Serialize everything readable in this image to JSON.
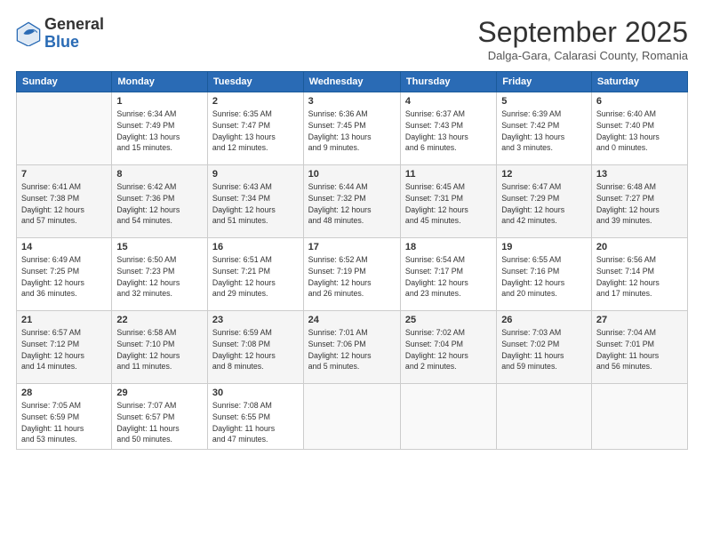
{
  "header": {
    "logo_general": "General",
    "logo_blue": "Blue",
    "month_title": "September 2025",
    "location": "Dalga-Gara, Calarasi County, Romania"
  },
  "columns": [
    "Sunday",
    "Monday",
    "Tuesday",
    "Wednesday",
    "Thursday",
    "Friday",
    "Saturday"
  ],
  "weeks": [
    [
      {
        "day": "",
        "info": ""
      },
      {
        "day": "1",
        "info": "Sunrise: 6:34 AM\nSunset: 7:49 PM\nDaylight: 13 hours\nand 15 minutes."
      },
      {
        "day": "2",
        "info": "Sunrise: 6:35 AM\nSunset: 7:47 PM\nDaylight: 13 hours\nand 12 minutes."
      },
      {
        "day": "3",
        "info": "Sunrise: 6:36 AM\nSunset: 7:45 PM\nDaylight: 13 hours\nand 9 minutes."
      },
      {
        "day": "4",
        "info": "Sunrise: 6:37 AM\nSunset: 7:43 PM\nDaylight: 13 hours\nand 6 minutes."
      },
      {
        "day": "5",
        "info": "Sunrise: 6:39 AM\nSunset: 7:42 PM\nDaylight: 13 hours\nand 3 minutes."
      },
      {
        "day": "6",
        "info": "Sunrise: 6:40 AM\nSunset: 7:40 PM\nDaylight: 13 hours\nand 0 minutes."
      }
    ],
    [
      {
        "day": "7",
        "info": "Sunrise: 6:41 AM\nSunset: 7:38 PM\nDaylight: 12 hours\nand 57 minutes."
      },
      {
        "day": "8",
        "info": "Sunrise: 6:42 AM\nSunset: 7:36 PM\nDaylight: 12 hours\nand 54 minutes."
      },
      {
        "day": "9",
        "info": "Sunrise: 6:43 AM\nSunset: 7:34 PM\nDaylight: 12 hours\nand 51 minutes."
      },
      {
        "day": "10",
        "info": "Sunrise: 6:44 AM\nSunset: 7:32 PM\nDaylight: 12 hours\nand 48 minutes."
      },
      {
        "day": "11",
        "info": "Sunrise: 6:45 AM\nSunset: 7:31 PM\nDaylight: 12 hours\nand 45 minutes."
      },
      {
        "day": "12",
        "info": "Sunrise: 6:47 AM\nSunset: 7:29 PM\nDaylight: 12 hours\nand 42 minutes."
      },
      {
        "day": "13",
        "info": "Sunrise: 6:48 AM\nSunset: 7:27 PM\nDaylight: 12 hours\nand 39 minutes."
      }
    ],
    [
      {
        "day": "14",
        "info": "Sunrise: 6:49 AM\nSunset: 7:25 PM\nDaylight: 12 hours\nand 36 minutes."
      },
      {
        "day": "15",
        "info": "Sunrise: 6:50 AM\nSunset: 7:23 PM\nDaylight: 12 hours\nand 32 minutes."
      },
      {
        "day": "16",
        "info": "Sunrise: 6:51 AM\nSunset: 7:21 PM\nDaylight: 12 hours\nand 29 minutes."
      },
      {
        "day": "17",
        "info": "Sunrise: 6:52 AM\nSunset: 7:19 PM\nDaylight: 12 hours\nand 26 minutes."
      },
      {
        "day": "18",
        "info": "Sunrise: 6:54 AM\nSunset: 7:17 PM\nDaylight: 12 hours\nand 23 minutes."
      },
      {
        "day": "19",
        "info": "Sunrise: 6:55 AM\nSunset: 7:16 PM\nDaylight: 12 hours\nand 20 minutes."
      },
      {
        "day": "20",
        "info": "Sunrise: 6:56 AM\nSunset: 7:14 PM\nDaylight: 12 hours\nand 17 minutes."
      }
    ],
    [
      {
        "day": "21",
        "info": "Sunrise: 6:57 AM\nSunset: 7:12 PM\nDaylight: 12 hours\nand 14 minutes."
      },
      {
        "day": "22",
        "info": "Sunrise: 6:58 AM\nSunset: 7:10 PM\nDaylight: 12 hours\nand 11 minutes."
      },
      {
        "day": "23",
        "info": "Sunrise: 6:59 AM\nSunset: 7:08 PM\nDaylight: 12 hours\nand 8 minutes."
      },
      {
        "day": "24",
        "info": "Sunrise: 7:01 AM\nSunset: 7:06 PM\nDaylight: 12 hours\nand 5 minutes."
      },
      {
        "day": "25",
        "info": "Sunrise: 7:02 AM\nSunset: 7:04 PM\nDaylight: 12 hours\nand 2 minutes."
      },
      {
        "day": "26",
        "info": "Sunrise: 7:03 AM\nSunset: 7:02 PM\nDaylight: 11 hours\nand 59 minutes."
      },
      {
        "day": "27",
        "info": "Sunrise: 7:04 AM\nSunset: 7:01 PM\nDaylight: 11 hours\nand 56 minutes."
      }
    ],
    [
      {
        "day": "28",
        "info": "Sunrise: 7:05 AM\nSunset: 6:59 PM\nDaylight: 11 hours\nand 53 minutes."
      },
      {
        "day": "29",
        "info": "Sunrise: 7:07 AM\nSunset: 6:57 PM\nDaylight: 11 hours\nand 50 minutes."
      },
      {
        "day": "30",
        "info": "Sunrise: 7:08 AM\nSunset: 6:55 PM\nDaylight: 11 hours\nand 47 minutes."
      },
      {
        "day": "",
        "info": ""
      },
      {
        "day": "",
        "info": ""
      },
      {
        "day": "",
        "info": ""
      },
      {
        "day": "",
        "info": ""
      }
    ]
  ]
}
